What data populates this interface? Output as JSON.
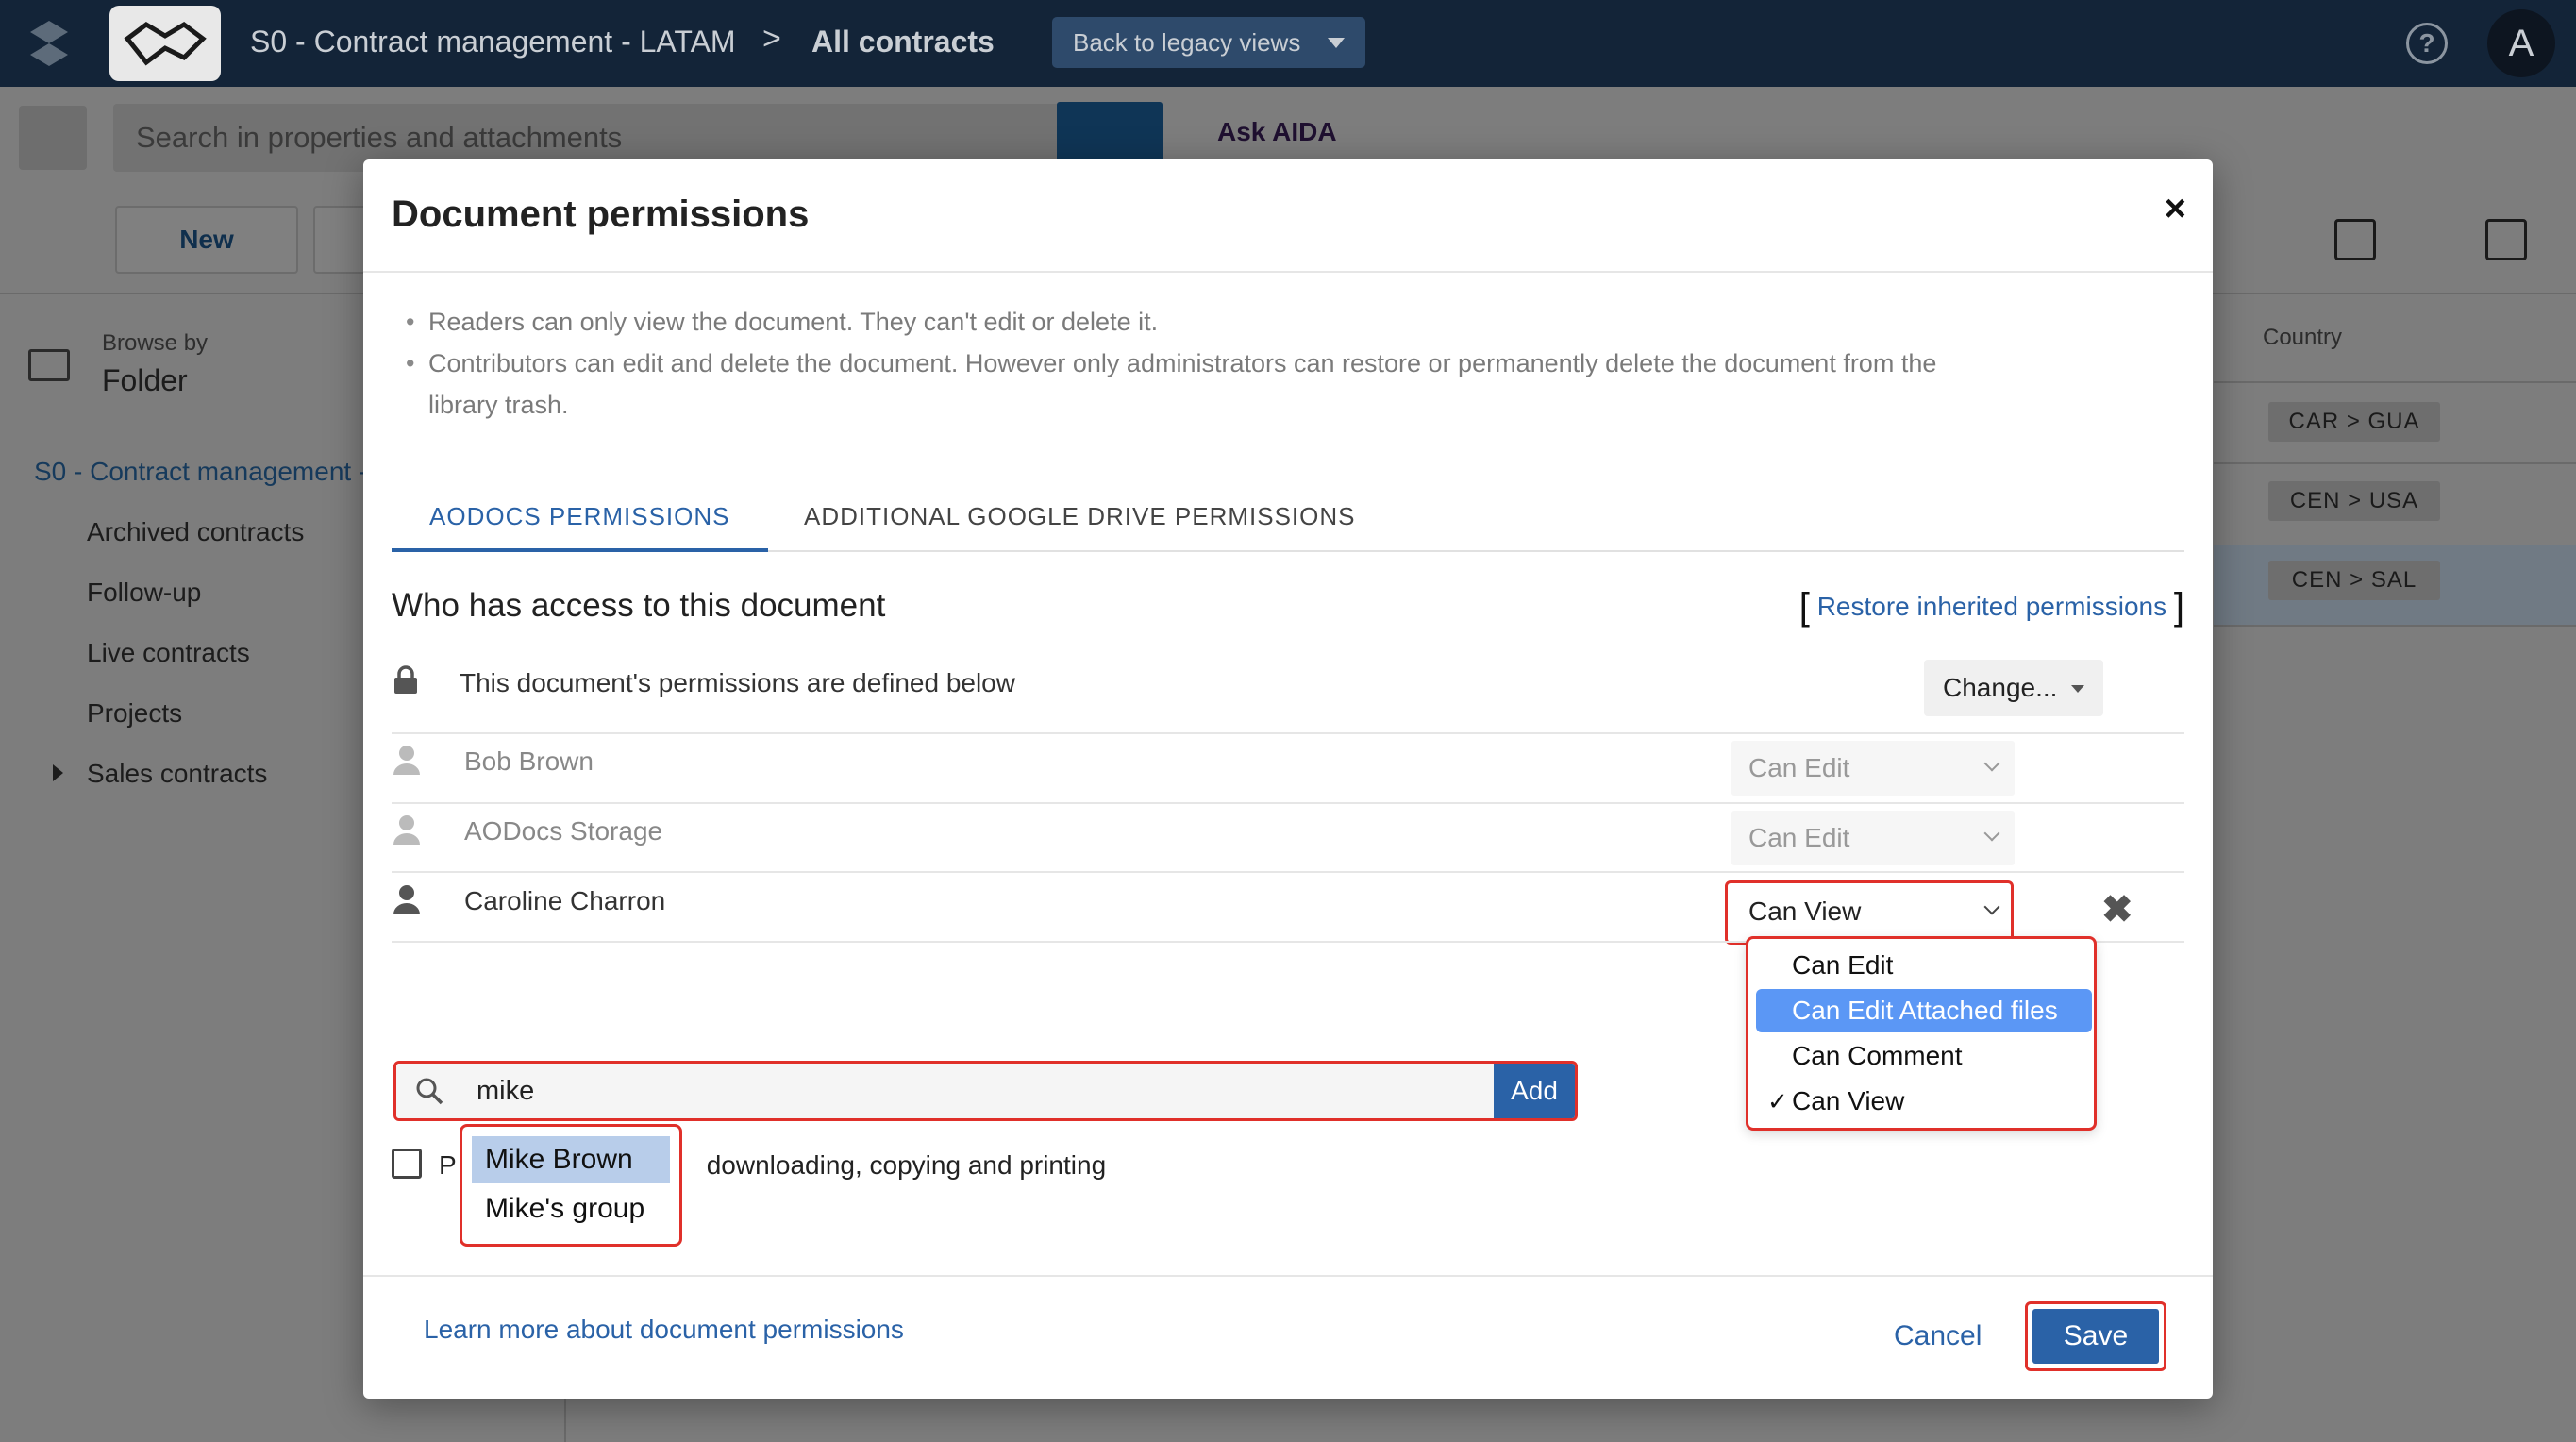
{
  "header": {
    "breadcrumb_library": "S0 - Contract management - LATAM",
    "breadcrumb_separator": ">",
    "breadcrumb_view": "All contracts",
    "legacy_button": "Back to legacy views",
    "help_symbol": "?",
    "avatar_initial": "A"
  },
  "toolbar": {
    "search_placeholder": "Search in properties and attachments",
    "ask_aida": "Ask AIDA",
    "new_label": "New"
  },
  "sidebar": {
    "browse_by_label": "Browse by",
    "browse_by_value": "Folder",
    "root": "S0 - Contract management -",
    "items": [
      "Archived contracts",
      "Follow-up",
      "Live contracts",
      "Projects",
      "Sales contracts"
    ]
  },
  "table": {
    "country_header": "Country",
    "country_chips": [
      "CAR  >  GUA",
      "CEN  >  USA",
      "CEN  >  SAL"
    ]
  },
  "modal": {
    "title": "Document permissions",
    "close_symbol": "×",
    "info": [
      "Readers can only view the document. They can't edit or delete it.",
      "Contributors can edit and delete the document. However only administrators can restore or permanently delete the document from the library trash."
    ],
    "tabs": [
      "AODOCS PERMISSIONS",
      "ADDITIONAL GOOGLE DRIVE PERMISSIONS"
    ],
    "who_title": "Who has access to this document",
    "restore_link": "Restore inherited permissions",
    "bracket_open": "[",
    "bracket_close": "]",
    "permissions_defined": "This document's permissions are defined below",
    "change_button": "Change...",
    "people": [
      {
        "name": "Bob Brown",
        "role": "Can Edit"
      },
      {
        "name": "AODocs Storage",
        "role": "Can Edit"
      },
      {
        "name": "Caroline Charron",
        "role": "Can View"
      }
    ],
    "remove_symbol": "✖",
    "role_options": [
      "Can Edit",
      "Can Edit Attached files",
      "Can Comment",
      "Can View"
    ],
    "role_checkmark": "✓",
    "search_value": "mike",
    "add_button": "Add",
    "prevent_prefix": "P",
    "prevent_suffix": "downloading, copying and printing",
    "suggestions": [
      "Mike Brown",
      "Mike's group"
    ],
    "learn_more": "Learn more about document permissions",
    "cancel": "Cancel",
    "save": "Save"
  },
  "colors": {
    "accent": "#2a62a7",
    "highlight_outline": "#e0302a",
    "selected_option": "#5b97f5",
    "topbar": "#132438"
  }
}
